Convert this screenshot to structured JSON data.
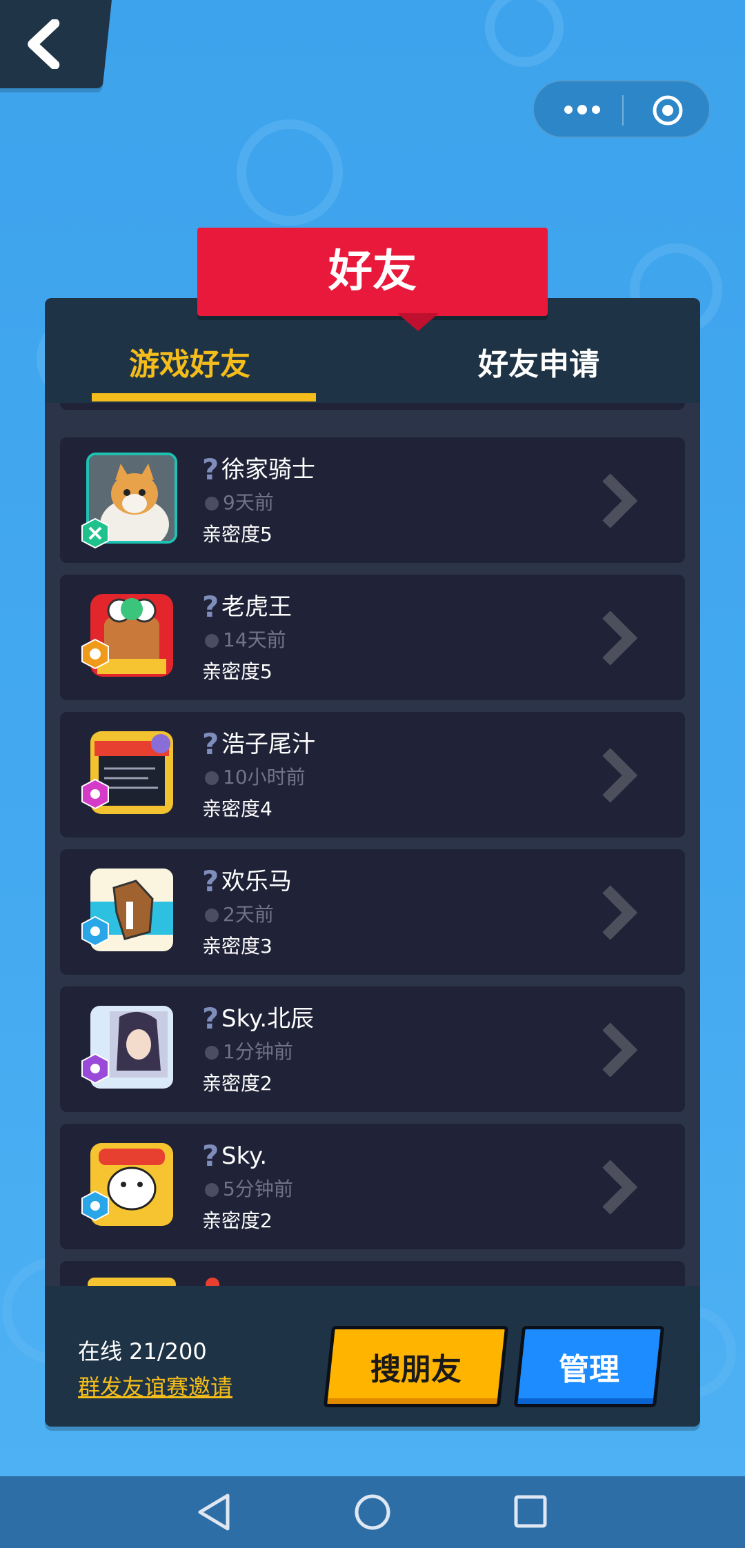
{
  "window": {
    "title": "好友"
  },
  "topbar": {
    "back_icon": "chevron-left-icon",
    "capsule_more_icon": "more-dots-icon",
    "capsule_close_icon": "target-circle-icon"
  },
  "tabs": [
    {
      "label": "游戏好友",
      "active": true
    },
    {
      "label": "好友申请",
      "active": false
    }
  ],
  "friends": [
    {
      "name": "徐家骑士",
      "last_seen": "9天前",
      "intimacy": "亲密度5",
      "avatar": "avatar-cat",
      "badge_color": "#1fc28c"
    },
    {
      "name": "老虎王",
      "last_seen": "14天前",
      "intimacy": "亲密度5",
      "avatar": "avatar-lion",
      "badge_color": "#f09a1a"
    },
    {
      "name": "浩子尾汁",
      "last_seen": "10小时前",
      "intimacy": "亲密度4",
      "avatar": "avatar-poster",
      "badge_color": "#d43cc8"
    },
    {
      "name": "欢乐马",
      "last_seen": "2天前",
      "intimacy": "亲密度3",
      "avatar": "avatar-horse",
      "badge_color": "#28a6e8"
    },
    {
      "name": "Sky.北辰",
      "last_seen": "1分钟前",
      "intimacy": "亲密度2",
      "avatar": "avatar-anime",
      "badge_color": "#9a4ad8"
    },
    {
      "name": "Sky.",
      "last_seen": "5分钟前",
      "intimacy": "亲密度2",
      "avatar": "avatar-cartoon",
      "badge_color": "#28a6e8"
    }
  ],
  "footer": {
    "online": "在线 21/200",
    "invite_link": "群发友谊赛邀请",
    "search_button": "搜朋友",
    "manage_button": "管理"
  },
  "colors": {
    "accent": "#f5bd1b",
    "title_red": "#e8193a",
    "panel": "#2b3448",
    "card": "#202237"
  },
  "navbar": {
    "back_icon": "triangle-back-icon",
    "home_icon": "circle-home-icon",
    "recent_icon": "square-recent-icon"
  }
}
